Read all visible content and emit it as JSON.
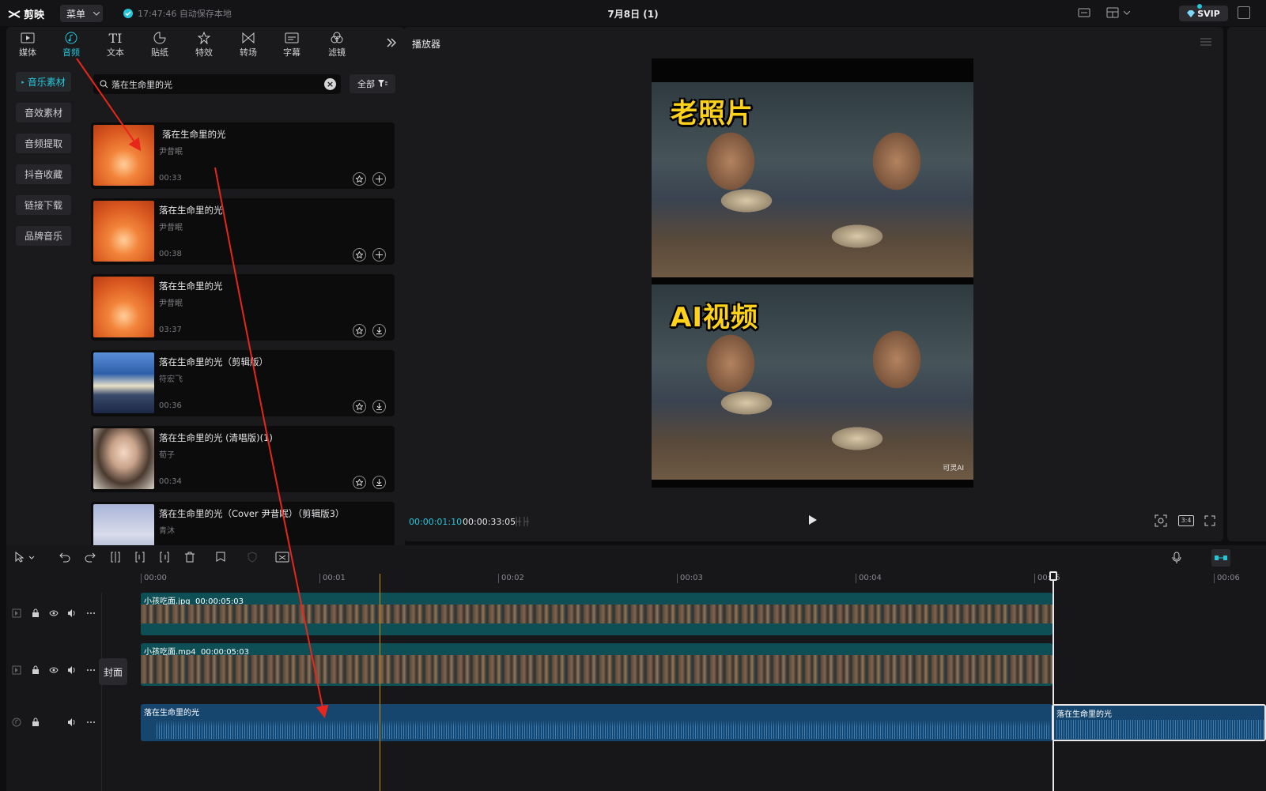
{
  "app": {
    "name": "剪映",
    "menu_label": "菜单",
    "autosave_text": "17:47:46 自动保存本地",
    "project_title": "7月8日 (1)",
    "svip_label": "SVIP"
  },
  "left_panel": {
    "tabs": [
      {
        "label": "媒体",
        "icon": "media-icon"
      },
      {
        "label": "音频",
        "icon": "audio-icon"
      },
      {
        "label": "文本",
        "icon": "text-icon"
      },
      {
        "label": "贴纸",
        "icon": "sticker-icon"
      },
      {
        "label": "特效",
        "icon": "effects-icon"
      },
      {
        "label": "转场",
        "icon": "transition-icon"
      },
      {
        "label": "字幕",
        "icon": "subtitle-icon"
      },
      {
        "label": "滤镜",
        "icon": "filter-icon"
      }
    ],
    "active_tab": "音频",
    "categories": [
      "音乐素材",
      "音效素材",
      "音频提取",
      "抖音收藏",
      "链接下载",
      "品牌音乐"
    ],
    "active_category": "音乐素材",
    "search": {
      "value": "落在生命里的光"
    },
    "filter_label": "全部",
    "results": [
      {
        "title": "落在生命里的光",
        "artist": "尹昔眠",
        "duration": "00:33",
        "action": "add"
      },
      {
        "title": "落在生命里的光",
        "artist": "尹昔眠",
        "duration": "00:38",
        "action": "add"
      },
      {
        "title": "落在生命里的光",
        "artist": "尹昔眠",
        "duration": "03:37",
        "action": "download"
      },
      {
        "title": "落在生命里的光（剪辑版）",
        "artist": "符宏飞",
        "duration": "00:36",
        "action": "download"
      },
      {
        "title": "落在生命里的光 (清唱版)(1)",
        "artist": "荀子",
        "duration": "00:34",
        "action": "download"
      },
      {
        "title": "落在生命里的光（Cover 尹昔眠）（剪辑版3）",
        "artist": "青沐",
        "duration": "",
        "action": ""
      }
    ]
  },
  "player": {
    "title": "播放器",
    "caption_top": "老照片",
    "caption_bottom": "AI视频",
    "watermark": "可灵AI",
    "current_time": "00:00:01:10",
    "total_time": "00:00:33:05",
    "aspect_label": "3:4"
  },
  "timeline": {
    "ruler_labels": [
      "00:00",
      "00:01",
      "00:02",
      "00:03",
      "00:04",
      "00:05",
      "00:06"
    ],
    "cover_label": "封面",
    "tracks": [
      {
        "name": "小孩吃面.jpg",
        "duration": "00:00:05:03",
        "kind": "video"
      },
      {
        "name": "小孩吃面.mp4",
        "duration": "00:00:05:03",
        "kind": "video"
      },
      {
        "name": "落在生命里的光",
        "kind": "audio"
      },
      {
        "name": "落在生命里的光",
        "kind": "audio"
      }
    ]
  },
  "colors": {
    "accent": "#26c6da",
    "video_clip": "#0d4f55",
    "audio_clip": "#16466e",
    "annotation_arrow": "#e8261c"
  }
}
